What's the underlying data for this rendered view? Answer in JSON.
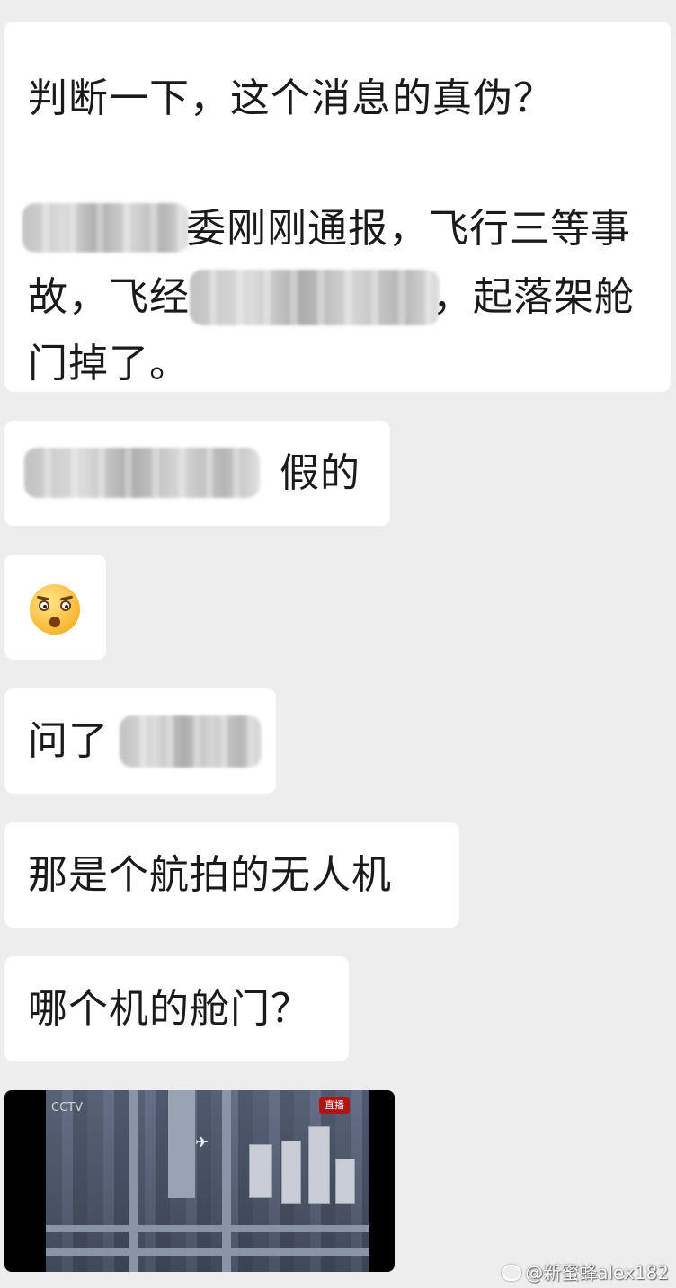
{
  "messages": [
    {
      "line1": "判断一下，这个消息的真伪？",
      "line3_visible": "委刚刚通报，飞行三等事",
      "line4_prefix": "故，飞经",
      "line4_suffix": "，起落架舱",
      "line5": "门掉了。"
    },
    {
      "text_visible": "假的"
    },
    {
      "emoji": "flushed-face"
    },
    {
      "text_prefix": "问了"
    },
    {
      "text": "那是个航拍的无人机"
    },
    {
      "text": "哪个机的舱门？"
    }
  ],
  "video": {
    "channel_logo": "CCTV",
    "badge_text": "直播"
  },
  "watermark": {
    "text": "@新蜜蜂alex182"
  }
}
